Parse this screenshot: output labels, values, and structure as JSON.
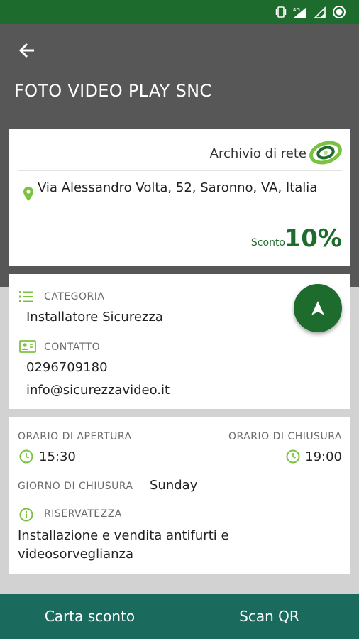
{
  "colors": {
    "status_bar": "#1e6b2e",
    "app_bar": "#575757",
    "accent_green": "#1e6b2e",
    "icon_green": "#8bc34a",
    "bottom_bar": "#1a6a5e"
  },
  "status_bar": {
    "icons": [
      "vibrate-icon",
      "signal-4g-icon",
      "signal-icon",
      "battery-icon"
    ]
  },
  "header": {
    "back_icon": "arrow-left-icon",
    "title": "FOTO VIDEO PLAY SNC"
  },
  "store_card": {
    "network_label": "Archivio di rete",
    "logo_icon": "network-logo-icon",
    "address_icon": "location-pin-icon",
    "address": "Via Alessandro Volta, 52, Saronno, VA, Italia",
    "discount_label": "Sconto",
    "discount_value": "10%"
  },
  "details_card": {
    "category_label": "CATEGORIA",
    "category_value": "Installatore Sicurezza",
    "contact_label": "CONTATTO",
    "phone": "0296709180",
    "email": "info@sicurezzavideo.it",
    "navigate_icon": "navigation-arrow-icon"
  },
  "hours_card": {
    "opening_label": "ORARIO DI APERTURA",
    "opening_time": "15:30",
    "closing_label": "ORARIO DI CHIUSURA",
    "closing_time": "19:00",
    "closed_day_label": "GIORNO DI CHIUSURA",
    "closed_day_value": "Sunday",
    "privacy_label": "RISERVATEZZA",
    "privacy_value": "Installazione e vendita antifurti e videosorveglianza"
  },
  "bottom_bar": {
    "left_label": "Carta sconto",
    "right_label": "Scan QR"
  }
}
